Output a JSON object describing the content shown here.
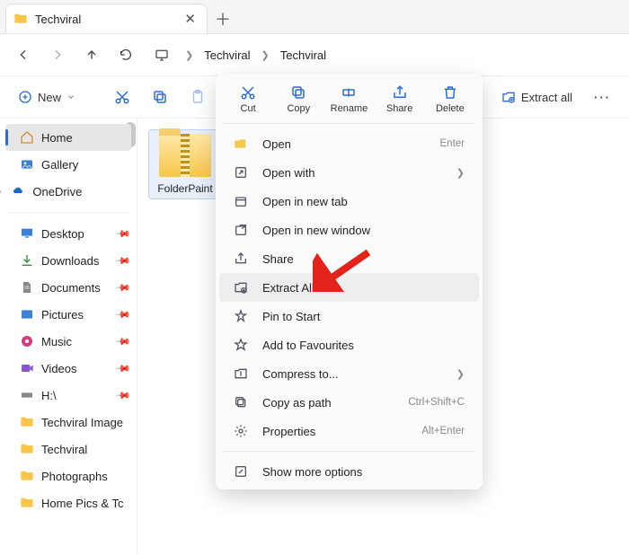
{
  "tab": {
    "title": "Techviral"
  },
  "breadcrumb": {
    "root": "Techviral",
    "current": "Techviral"
  },
  "toolbar": {
    "new_label": "New",
    "extract_all_label": "Extract all"
  },
  "sidebar": {
    "home": "Home",
    "gallery": "Gallery",
    "onedrive": "OneDrive",
    "quick": {
      "desktop": "Desktop",
      "downloads": "Downloads",
      "documents": "Documents",
      "pictures": "Pictures",
      "music": "Music",
      "videos": "Videos",
      "h_drive": "H:\\",
      "techviral_image": "Techviral Image",
      "techviral": "Techviral",
      "photographs": "Photographs",
      "home_pics": "Home Pics & Tc"
    }
  },
  "file": {
    "name": "FolderPaint"
  },
  "context_menu": {
    "top": {
      "cut": "Cut",
      "copy": "Copy",
      "rename": "Rename",
      "share": "Share",
      "delete": "Delete"
    },
    "items": {
      "open": "Open",
      "open_hint": "Enter",
      "open_with": "Open with",
      "open_new_tab": "Open in new tab",
      "open_new_window": "Open in new window",
      "share": "Share",
      "extract_all": "Extract All...",
      "pin_start": "Pin to Start",
      "add_fav": "Add to Favourites",
      "compress": "Compress to...",
      "copy_path": "Copy as path",
      "copy_path_hint": "Ctrl+Shift+C",
      "properties": "Properties",
      "properties_hint": "Alt+Enter",
      "show_more": "Show more options"
    }
  }
}
